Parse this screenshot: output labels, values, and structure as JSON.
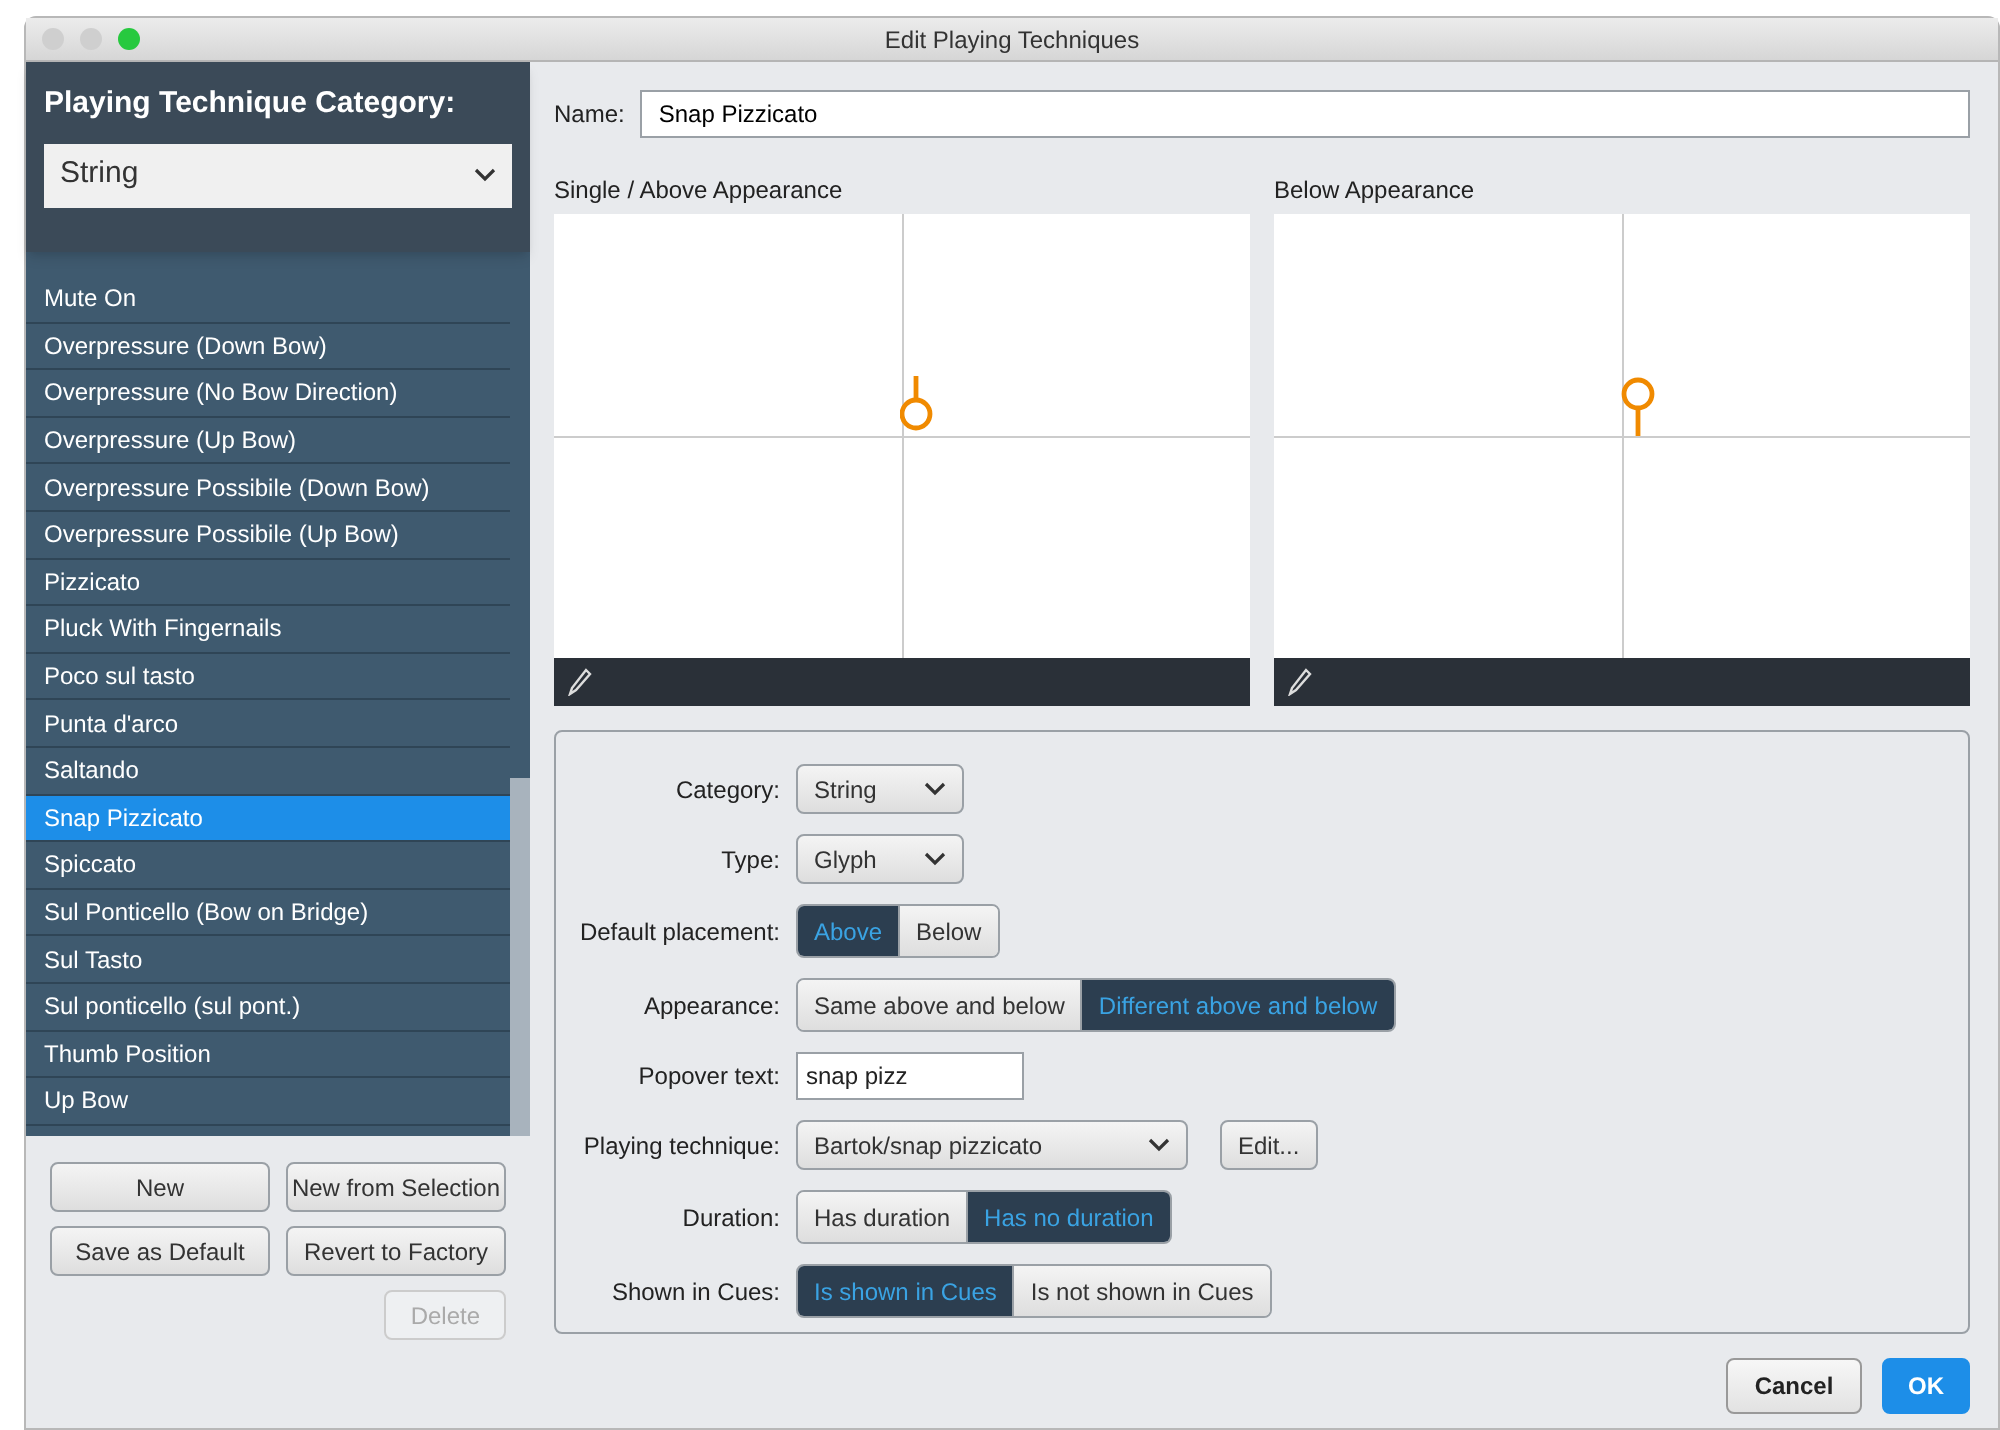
{
  "window": {
    "title": "Edit Playing Techniques"
  },
  "category_picker": {
    "label": "Playing Technique Category:",
    "value": "String"
  },
  "techniques": [
    {
      "label": "Mute On",
      "selected": false
    },
    {
      "label": "Overpressure (Down Bow)",
      "selected": false
    },
    {
      "label": "Overpressure (No Bow Direction)",
      "selected": false
    },
    {
      "label": "Overpressure (Up Bow)",
      "selected": false
    },
    {
      "label": "Overpressure Possibile (Down Bow)",
      "selected": false
    },
    {
      "label": "Overpressure Possibile (Up Bow)",
      "selected": false
    },
    {
      "label": "Pizzicato",
      "selected": false
    },
    {
      "label": "Pluck With Fingernails",
      "selected": false
    },
    {
      "label": "Poco sul tasto",
      "selected": false
    },
    {
      "label": "Punta d'arco",
      "selected": false
    },
    {
      "label": "Saltando",
      "selected": false
    },
    {
      "label": "Snap Pizzicato",
      "selected": true
    },
    {
      "label": "Spiccato",
      "selected": false
    },
    {
      "label": "Sul Ponticello (Bow on Bridge)",
      "selected": false
    },
    {
      "label": "Sul Tasto",
      "selected": false
    },
    {
      "label": "Sul ponticello (sul pont.)",
      "selected": false
    },
    {
      "label": "Thumb Position",
      "selected": false
    },
    {
      "label": "Up Bow",
      "selected": false
    }
  ],
  "list_buttons": [
    {
      "label": "New",
      "disabled": false
    },
    {
      "label": "New from Selection",
      "disabled": false
    },
    {
      "label": "Save as Default",
      "disabled": false
    },
    {
      "label": "Revert to Factory",
      "disabled": false
    },
    {
      "label": "Delete",
      "disabled": true
    }
  ],
  "name_field": {
    "label": "Name:",
    "value": "Snap Pizzicato"
  },
  "appearances": [
    {
      "title": "Single / Above Appearance",
      "kind": "stem_up"
    },
    {
      "title": "Below Appearance",
      "kind": "stem_down"
    }
  ],
  "properties": [
    {
      "kind": "dropdown",
      "label": "Category:",
      "value": "String"
    },
    {
      "kind": "dropdown",
      "label": "Type:",
      "value": "Glyph"
    },
    {
      "kind": "segmented",
      "label": "Default placement:",
      "options": [
        {
          "label": "Above",
          "selected": true
        },
        {
          "label": "Below",
          "selected": false
        }
      ]
    },
    {
      "kind": "segmented",
      "label": "Appearance:",
      "options": [
        {
          "label": "Same above and below",
          "selected": false
        },
        {
          "label": "Different above and below",
          "selected": true
        }
      ]
    },
    {
      "kind": "text",
      "label": "Popover text:",
      "value": "snap pizz"
    },
    {
      "kind": "dropdown",
      "label": "Playing technique:",
      "value": "Bartok/snap pizzicato",
      "button": "Edit..."
    },
    {
      "kind": "segmented",
      "label": "Duration:",
      "options": [
        {
          "label": "Has duration",
          "selected": false
        },
        {
          "label": "Has no duration",
          "selected": true
        }
      ]
    },
    {
      "kind": "segmented",
      "label": "Shown in Cues:",
      "options": [
        {
          "label": "Is shown in Cues",
          "selected": true
        },
        {
          "label": "Is not shown in Cues",
          "selected": false
        }
      ]
    }
  ],
  "footer_buttons": [
    {
      "label": "Cancel",
      "kind": "secondary"
    },
    {
      "label": "OK",
      "kind": "primary"
    }
  ]
}
